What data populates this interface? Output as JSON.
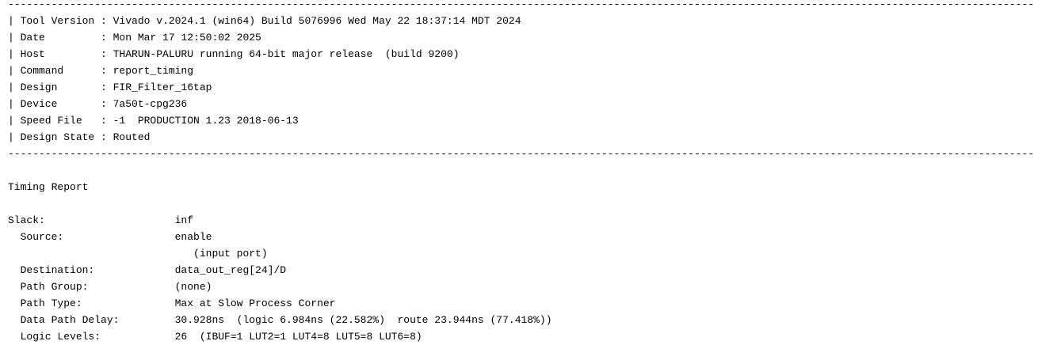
{
  "report": {
    "separator": "----------------------------------------------------------------------------------------------------------------------------------------------------------------------",
    "header_lines": [
      "| Tool Version : Vivado v.2024.1 (win64) Build 5076996 Wed May 22 18:37:14 MDT 2024",
      "| Date         : Mon Mar 17 12:50:02 2025",
      "| Host         : THARUN-PALURU running 64-bit major release  (build 9200)",
      "| Command      : report_timing",
      "| Design       : FIR_Filter_16tap",
      "| Device       : 7a50t-cpg236",
      "| Speed File   : -1  PRODUCTION 1.23 2018-06-13",
      "| Design State : Routed"
    ],
    "section_title": "Timing Report",
    "body_lines": [
      "Slack:                     inf",
      "  Source:                  enable",
      "                              (input port)",
      "  Destination:             data_out_reg[24]/D",
      "  Path Group:              (none)",
      "  Path Type:               Max at Slow Process Corner",
      "  Data Path Delay:         30.928ns  (logic 6.984ns (22.582%)  route 23.944ns (77.418%))",
      "  Logic Levels:            26  (IBUF=1 LUT2=1 LUT4=8 LUT5=8 LUT6=8)"
    ]
  }
}
